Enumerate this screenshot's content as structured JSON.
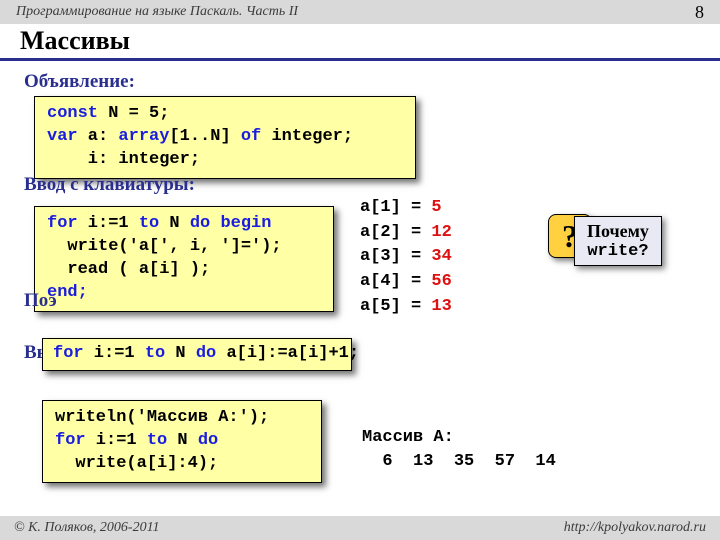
{
  "header": {
    "course": "Программирование на языке Паскаль. Часть II",
    "page": "8"
  },
  "title": "Массивы",
  "sections": {
    "decl": "Объявление:",
    "input": "Ввод с клавиатуры:",
    "process": "Поэ",
    "output": "Вы"
  },
  "code": {
    "decl_l1a": "const",
    "decl_l1b": " N = 5;",
    "decl_l2a": "var",
    "decl_l2b": " a: ",
    "decl_l2c": "array",
    "decl_l2d": "[1..N] ",
    "decl_l2e": "of",
    "decl_l2f": " integer;",
    "decl_l3": "    i: integer;",
    "input_l1a": "for",
    "input_l1b": " i:=1 ",
    "input_l1c": "to",
    "input_l1d": " N ",
    "input_l1e": "do begin",
    "input_l2": "  write('a[', i, ']=');",
    "input_l3": "  read ( a[i] );",
    "input_l4": "end;",
    "proc_l1a": "for",
    "proc_l1b": " i:=1 ",
    "proc_l1c": "to",
    "proc_l1d": " N ",
    "proc_l1e": "do",
    "proc_l1f": " a[i]:=a[i]+1;",
    "out_l1": "writeln('Массив A:');",
    "out_l2a": "for",
    "out_l2b": " i:=1 ",
    "out_l2c": "to",
    "out_l2d": " N ",
    "out_l2e": "do",
    "out_l3": "  write(a[i]:4);"
  },
  "values": [
    {
      "label": "a[1] =",
      "num": "5"
    },
    {
      "label": "a[2] =",
      "num": "12"
    },
    {
      "label": "a[3] =",
      "num": "34"
    },
    {
      "label": "a[4] =",
      "num": "56"
    },
    {
      "label": "a[5] =",
      "num": "13"
    }
  ],
  "question": "?",
  "callout": {
    "line1": "Почему",
    "line2": "write?"
  },
  "output": {
    "label": "Массив A:",
    "row": "  6  13  35  57  14"
  },
  "footer": {
    "author": "© К. Поляков, 2006-2011",
    "url": "http://kpolyakov.narod.ru"
  }
}
